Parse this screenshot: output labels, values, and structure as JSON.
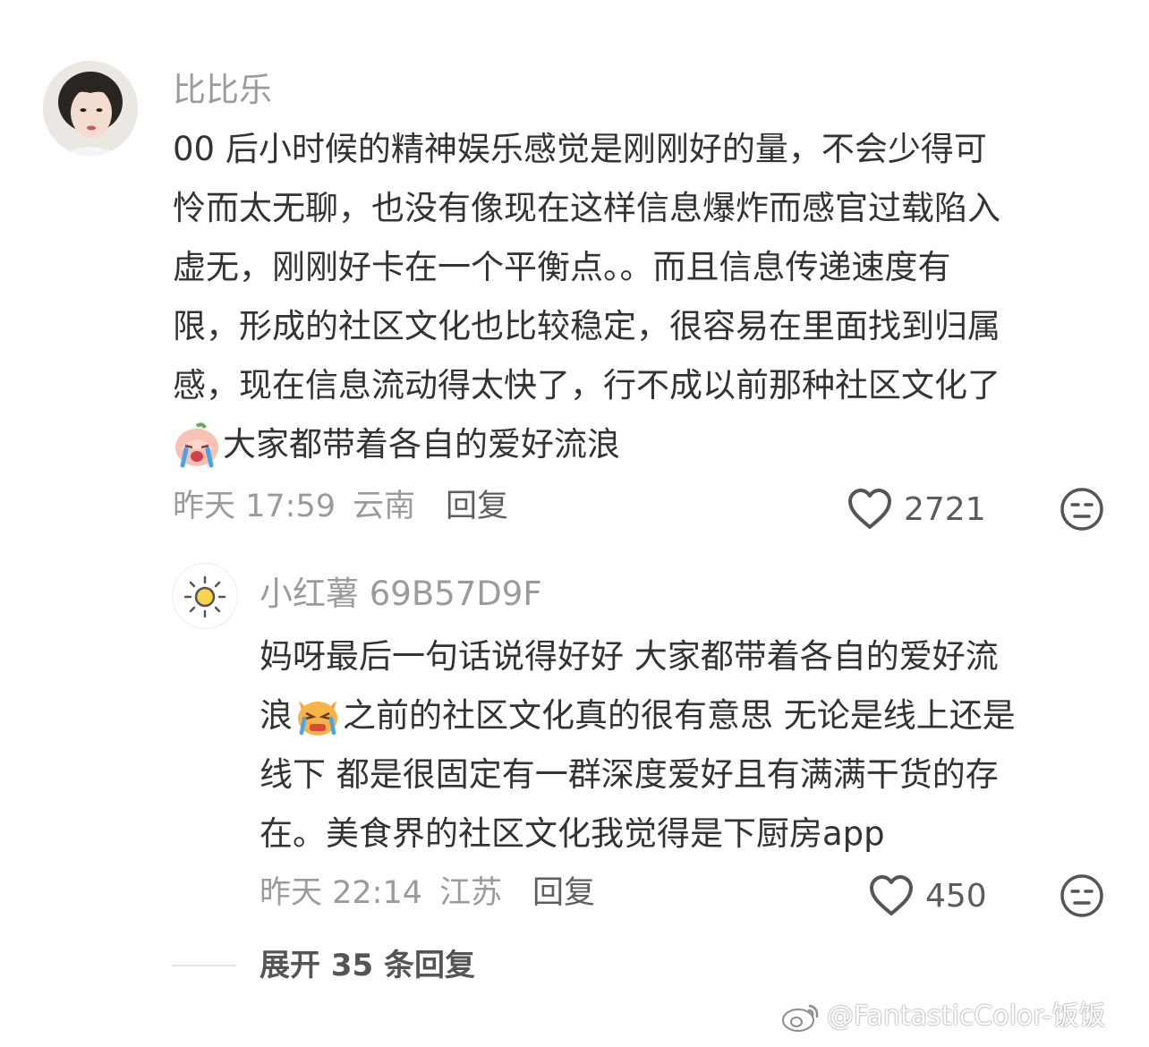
{
  "comment": {
    "username": "比比乐",
    "text_lines": [
      "00 后小时候的精神娱乐感觉是刚刚好的量，不会少得可",
      "怜而太无聊，也没有像现在这样信息爆炸而感官过载陷入",
      "虚无，刚刚好卡在一个平衡点。。而且信息传递速度有",
      "限，形成的社区文化也比较稳定，很容易在里面找到归属",
      "感，现在信息流动得太快了，行不成以前那种社区文化了",
      "大家都带着各自的爱好流浪"
    ],
    "emoji": "crying-peach-emoji",
    "time": "昨天 17:59",
    "location": "云南",
    "reply_label": "回复",
    "likes": "2721"
  },
  "reply": {
    "username": "小红薯 69B57D9F",
    "text_lines": [
      "妈呀最后一句话说得好好 大家都带着各自的爱好流",
      "之前的社区文化真的很有意思 无论是线上还是",
      "线下 都是很固定有一群深度爱好且有满满干货的存",
      "在。美食界的社区文化我觉得是下厨房app"
    ],
    "line2_prefix": "浪",
    "emoji": "crying-cat-emoji",
    "time": "昨天 22:14",
    "location": "江苏",
    "reply_label": "回复",
    "likes": "450"
  },
  "expand_label": "展开 35 条回复",
  "watermark": "@FantasticColor-饭饭",
  "colors": {
    "text": "#333333",
    "secondary": "#9b9b9b",
    "icon": "#555555",
    "background": "#ffffff"
  }
}
